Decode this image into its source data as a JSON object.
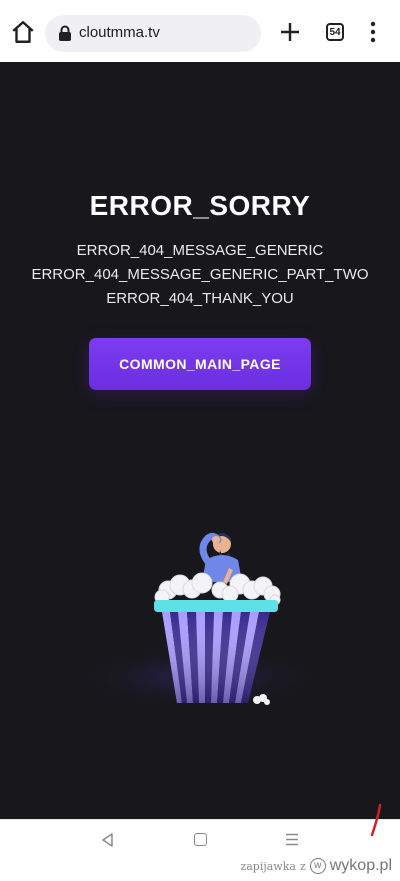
{
  "browser": {
    "url": "cloutmma.tv",
    "tab_count": "54",
    "icons": [
      "home-icon",
      "lock-icon",
      "plus-icon",
      "tab-switcher-icon",
      "more-vert-icon"
    ]
  },
  "page": {
    "title": "ERROR_SORRY",
    "message_lines": [
      "ERROR_404_MESSAGE_GENERIC",
      "ERROR_404_MESSAGE_GENERIC_PART_TWO",
      "ERROR_404_THANK_YOU"
    ],
    "cta_label": "COMMON_MAIN_PAGE",
    "colors": {
      "background": "#18171b",
      "accent": "#7b3cf0",
      "cup_stripe_light": "#a99cff",
      "cup_stripe_dark": "#3a2a8f",
      "rim": "#5ee0e6"
    }
  },
  "navbar": {
    "icons": [
      "back-icon",
      "home-square-icon",
      "recents-icon"
    ]
  },
  "watermark": {
    "user": "zapijawka",
    "word": "z",
    "logo_glyph": "w",
    "site": "wykop.pl"
  }
}
